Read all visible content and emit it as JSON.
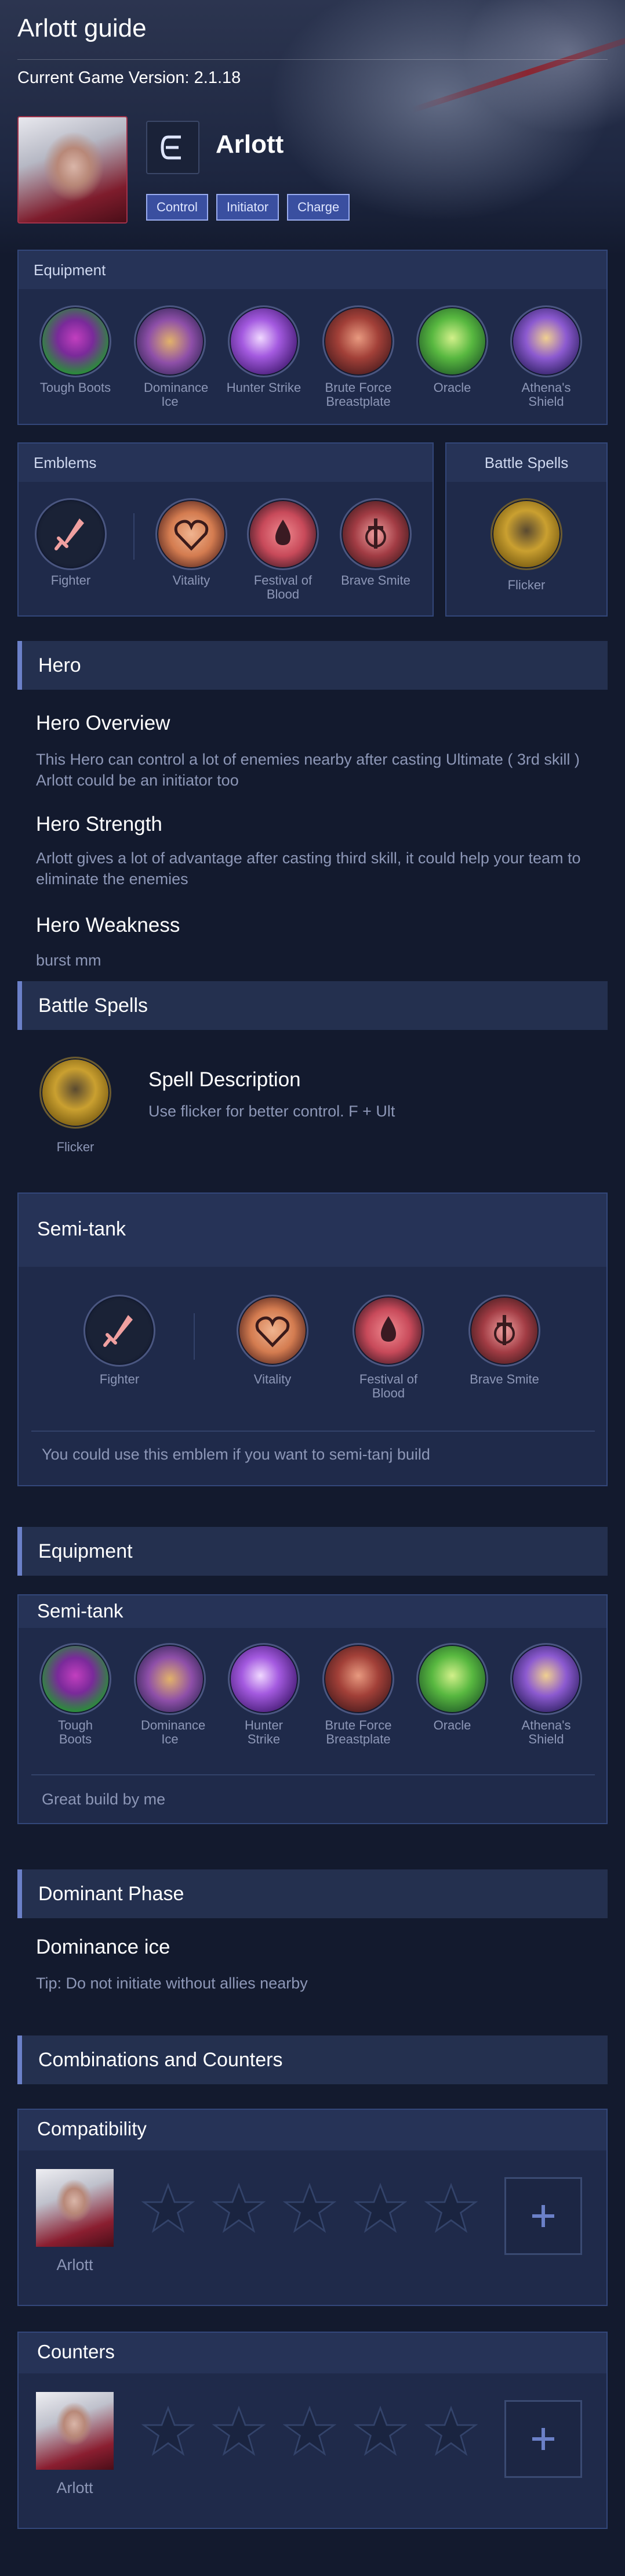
{
  "header": {
    "title": "Arlott guide",
    "version": "Current Game Version: 2.1.18"
  },
  "hero": {
    "name": "Arlott",
    "class_icon": "assassin-class-icon",
    "tags": [
      "Control",
      "Initiator",
      "Charge"
    ]
  },
  "equipment_panel": {
    "title": "Equipment",
    "items": [
      {
        "label": "Tough Boots",
        "icon": "tough-boots-icon"
      },
      {
        "label": "Dominance Ice",
        "icon": "dominance-ice-icon"
      },
      {
        "label": "Hunter Strike",
        "icon": "hunter-strike-icon"
      },
      {
        "label": "Brute Force Breastplate",
        "icon": "brute-force-breastplate-icon"
      },
      {
        "label": "Oracle",
        "icon": "oracle-icon"
      },
      {
        "label": "Athena's Shield",
        "icon": "athenas-shield-icon"
      }
    ]
  },
  "emblems_panel": {
    "title": "Emblems",
    "main": {
      "label": "Fighter",
      "icon": "fighter-emblem-icon"
    },
    "talents": [
      {
        "label": "Vitality",
        "icon": "vitality-icon"
      },
      {
        "label": "Festival of Blood",
        "icon": "festival-of-blood-icon"
      },
      {
        "label": "Brave Smite",
        "icon": "brave-smite-icon"
      }
    ]
  },
  "battle_spells_panel": {
    "title": "Battle Spells",
    "spell": {
      "label": "Flicker",
      "icon": "flicker-icon"
    }
  },
  "hero_section": {
    "title": "Hero",
    "overview_title": "Hero Overview",
    "overview_text": "This Hero can control a lot of enemies nearby after casting Ultimate ( 3rd skill ) Arlott could be an initiator too",
    "strength_title": "Hero Strength",
    "strength_text": "Arlott gives a lot of advantage after casting third skill, it could help your team to eliminate the enemies",
    "weakness_title": "Hero Weakness",
    "weakness_text": "burst mm"
  },
  "spells_section": {
    "title": "Battle Spells",
    "spell_label": "Flicker",
    "desc_title": "Spell Description",
    "desc_text": "Use flicker for better control. F + Ult"
  },
  "emblem_build": {
    "title": "Semi-tank",
    "main": "Fighter",
    "talents": [
      "Vitality",
      "Festival of Blood",
      "Brave Smite"
    ],
    "note": "You could use this emblem if you want to semi-tanj build"
  },
  "equipment_section": {
    "title": "Equipment",
    "build_title": "Semi-tank",
    "items": [
      "Tough Boots",
      "Dominance Ice",
      "Hunter Strike",
      "Brute Force Breastplate",
      "Oracle",
      "Athena's Shield"
    ],
    "note": "Great build by me"
  },
  "dominant_phase": {
    "title": "Dominant Phase",
    "subtitle": "Dominance ice",
    "tip": "Tip: Do not initiate without allies nearby"
  },
  "combos": {
    "title": "Combinations and Counters",
    "compatibility": {
      "title": "Compatibility",
      "hero": "Arlott",
      "stars": 0,
      "max_stars": 5
    },
    "counters": {
      "title": "Counters",
      "hero": "Arlott",
      "stars": 0,
      "max_stars": 5
    }
  },
  "colors": {
    "background": "#131a2e",
    "panel": "#1f2a4a",
    "accent": "#6b80c8",
    "tag": "#3a4fa0"
  }
}
